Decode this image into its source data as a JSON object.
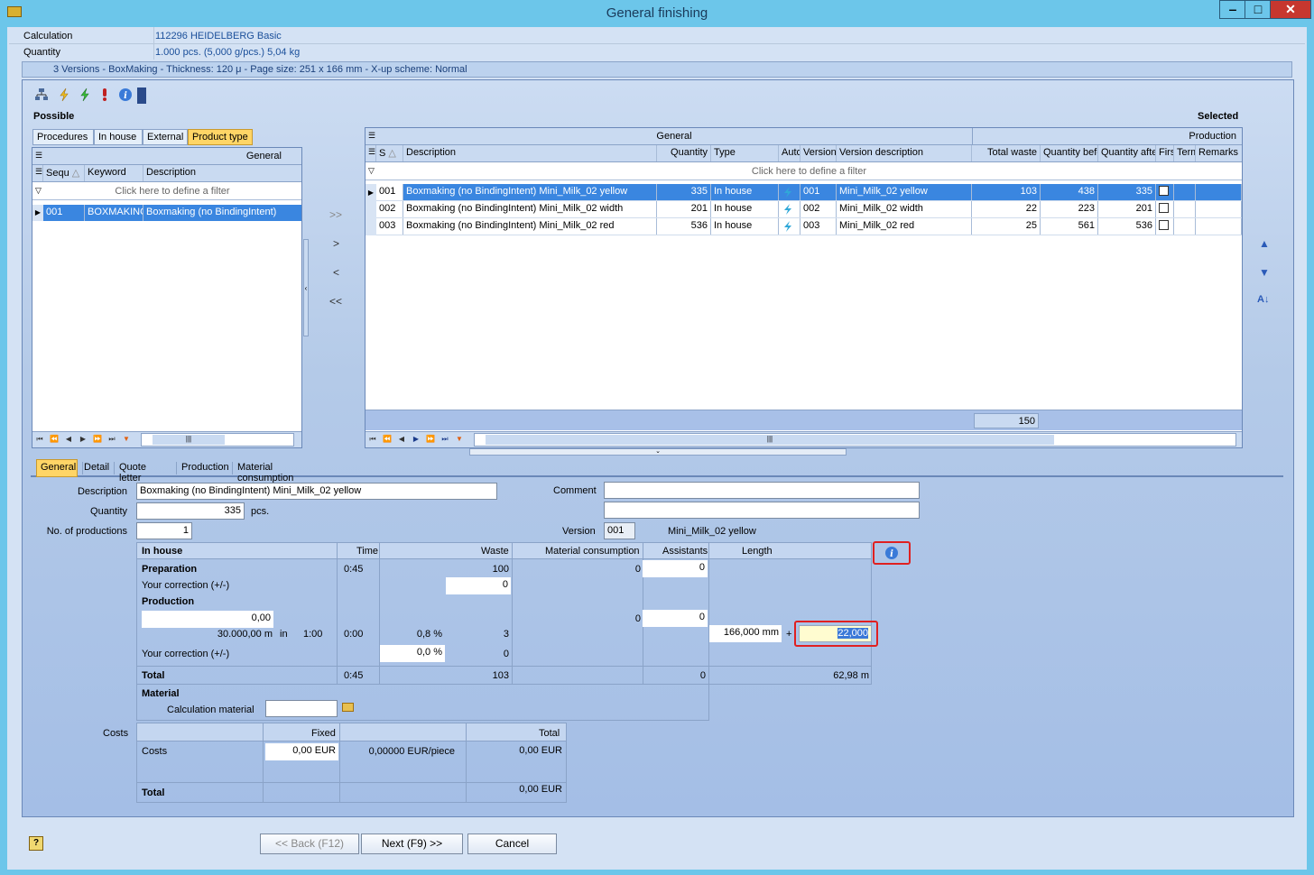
{
  "window": {
    "title": "General finishing",
    "min": "‒",
    "max": "□",
    "close": "✕"
  },
  "header": {
    "calc_label": "Calculation",
    "calc_value": "112296 HEIDELBERG Basic",
    "qty_label": "Quantity",
    "qty_value": "1.000 pcs. (5,000 g/pcs.) 5,04 kg",
    "versions": "3 Versions - BoxMaking - Thickness: 120 μ - Page size: 251 x 166 mm - X-up scheme: Normal"
  },
  "possible": {
    "title": "Possible",
    "tabs": [
      "Procedures",
      "In house",
      "External",
      "Product type"
    ],
    "group": "General",
    "cols": [
      "Sequ",
      "Keyword",
      "Description"
    ],
    "filter": "Click here to define a filter",
    "row": {
      "seq": "001",
      "keyword": "BOXMAKING",
      "desc": "Boxmaking (no BindingIntent)"
    }
  },
  "transfer": {
    "all_right": ">>",
    "right": ">",
    "left": "<",
    "all_left": "<<"
  },
  "selected": {
    "title": "Selected",
    "group_general": "General",
    "group_production": "Production",
    "cols": [
      "S",
      "Description",
      "Quantity",
      "Type",
      "Auto",
      "Version",
      "Version description",
      "Total waste",
      "Quantity before",
      "Quantity after",
      "First",
      "Term",
      "Remarks"
    ],
    "filter": "Click here to define a filter",
    "rows": [
      {
        "s": "001",
        "desc": "Boxmaking (no BindingIntent) Mini_Milk_02 yellow",
        "qty": "335",
        "type": "In house",
        "ver": "001",
        "verdesc": "Mini_Milk_02 yellow",
        "waste": "103",
        "before": "438",
        "after": "335",
        "first": "✔"
      },
      {
        "s": "002",
        "desc": "Boxmaking (no BindingIntent) Mini_Milk_02 width",
        "qty": "201",
        "type": "In house",
        "ver": "002",
        "verdesc": "Mini_Milk_02 width",
        "waste": "22",
        "before": "223",
        "after": "201",
        "first": ""
      },
      {
        "s": "003",
        "desc": "Boxmaking (no BindingIntent) Mini_Milk_02 red",
        "qty": "536",
        "type": "In house",
        "ver": "003",
        "verdesc": "Mini_Milk_02 red",
        "waste": "25",
        "before": "561",
        "after": "536",
        "first": ""
      }
    ],
    "total_waste": "150"
  },
  "detail_tabs": [
    "General",
    "Detail",
    "Quote letter",
    "Production",
    "Material consumption"
  ],
  "form": {
    "desc_label": "Description",
    "desc_value": "Boxmaking (no BindingIntent) Mini_Milk_02 yellow",
    "qty_label": "Quantity",
    "qty_value": "335",
    "qty_unit": "pcs.",
    "nprod_label": "No. of productions",
    "nprod_value": "1",
    "comment_label": "Comment",
    "comment_value": "",
    "version_label": "Version",
    "version_value": "001",
    "version_desc": "Mini_Milk_02 yellow"
  },
  "prod": {
    "h_inhouse": "In house",
    "h_time": "Time",
    "h_waste": "Waste",
    "h_mat": "Material consumption",
    "h_assist": "Assistants",
    "h_length": "Length",
    "prep": "Preparation",
    "prep_time": "0:45",
    "prep_waste": "100",
    "prep_mat": "0",
    "prep_assist": "0",
    "corr": "Your correction (+/-)",
    "corr_waste": "0",
    "production": "Production",
    "prod_input": "0,00",
    "prod_mat": "0",
    "prod_assist": "0",
    "speed": "30.000,00 m",
    "speed_in": "in",
    "speed_ratio": "1:00",
    "speed_time": "0:00",
    "speed_pct": "0,8 %",
    "speed_waste": "3",
    "length": "166,000 mm",
    "plus": "+",
    "length_add": "22,000",
    "corr2": "Your correction (+/-)",
    "corr2_pct": "0,0 %",
    "corr2_waste": "0",
    "total": "Total",
    "total_time": "0:45",
    "total_waste": "103",
    "total_assist": "0",
    "total_length": "62,98 m",
    "material": "Material",
    "calc_material": "Calculation material",
    "calc_material_value": ""
  },
  "costs": {
    "label": "Costs",
    "h_fixed": "Fixed",
    "h_total": "Total",
    "row": "Costs",
    "fixed": "0,00 EUR",
    "per_piece": "0,00000 EUR/piece",
    "row_total": "0,00 EUR",
    "total": "Total",
    "total_value": "0,00 EUR"
  },
  "buttons": {
    "back": "<< Back (F12)",
    "next": "Next (F9) >>",
    "cancel": "Cancel"
  },
  "colors": {
    "title_bar": "#6cc6ea",
    "selection": "#3a86e0",
    "active_tab": "#ffd566",
    "highlight": "#e02020"
  }
}
